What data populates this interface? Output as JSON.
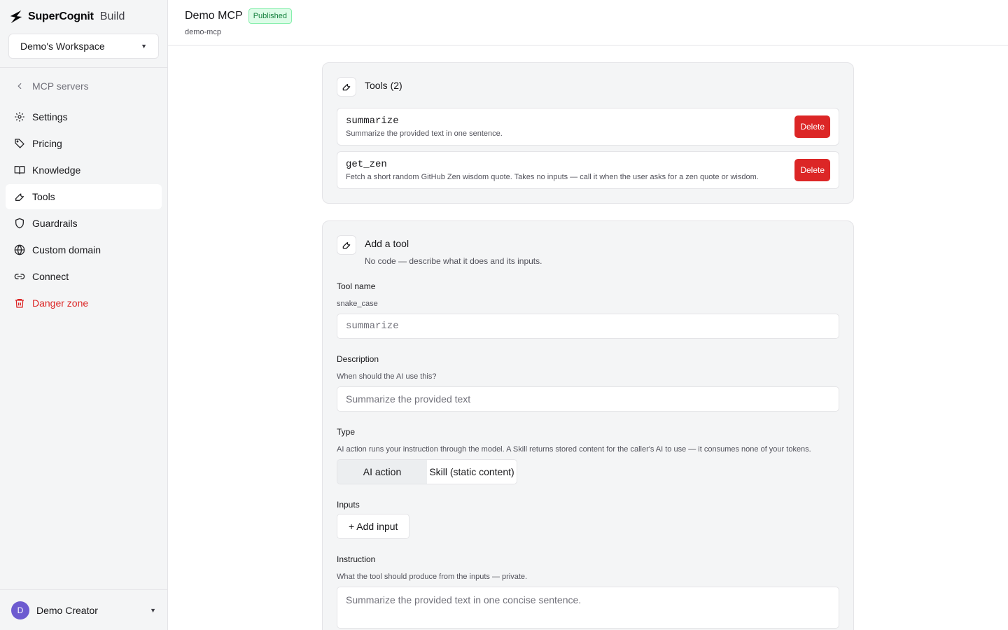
{
  "brand": {
    "name": "SuperCognit",
    "suffix": "Build"
  },
  "workspace": {
    "label": "Demo's Workspace"
  },
  "sidebar": {
    "back_label": "MCP servers",
    "items": [
      {
        "label": "Settings",
        "icon": "gear-icon"
      },
      {
        "label": "Pricing",
        "icon": "tag-icon"
      },
      {
        "label": "Knowledge",
        "icon": "book-icon"
      },
      {
        "label": "Tools",
        "icon": "wrench-icon",
        "active": true
      },
      {
        "label": "Guardrails",
        "icon": "shield-icon"
      },
      {
        "label": "Custom domain",
        "icon": "globe-icon"
      },
      {
        "label": "Connect",
        "icon": "link-icon"
      },
      {
        "label": "Danger zone",
        "icon": "trash-icon",
        "danger": true
      }
    ]
  },
  "user": {
    "initial": "D",
    "name": "Demo Creator"
  },
  "header": {
    "title": "Demo MCP",
    "status": "Published",
    "slug": "demo-mcp"
  },
  "tools_card": {
    "title": "Tools (2)",
    "tools": [
      {
        "name": "summarize",
        "description": "Summarize the provided text in one sentence.",
        "delete_label": "Delete"
      },
      {
        "name": "get_zen",
        "description": "Fetch a short random GitHub Zen wisdom quote. Takes no inputs — call it when the user asks for a zen quote or wisdom.",
        "delete_label": "Delete"
      }
    ]
  },
  "add_tool": {
    "title": "Add a tool",
    "subtitle": "No code — describe what it does and its inputs.",
    "name_field": {
      "label": "Tool name",
      "help": "snake_case",
      "placeholder": "summarize",
      "value": ""
    },
    "description_field": {
      "label": "Description",
      "help": "When should the AI use this?",
      "placeholder": "Summarize the provided text",
      "value": ""
    },
    "type_field": {
      "label": "Type",
      "help": "AI action runs your instruction through the model. A Skill returns stored content for the caller's AI to use — it consumes none of your tokens.",
      "options": [
        "AI action",
        "Skill (static content)"
      ],
      "selected": "AI action"
    },
    "inputs_field": {
      "label": "Inputs",
      "add_label": "+ Add input"
    },
    "instruction_field": {
      "label": "Instruction",
      "help": "What the tool should produce from the inputs — private.",
      "placeholder": "Summarize the provided text in one concise sentence.",
      "value": ""
    }
  },
  "colors": {
    "danger": "#dc2626",
    "published_bg": "#dcfce7",
    "published_text": "#15803d",
    "avatar": "#6d5bd0"
  }
}
